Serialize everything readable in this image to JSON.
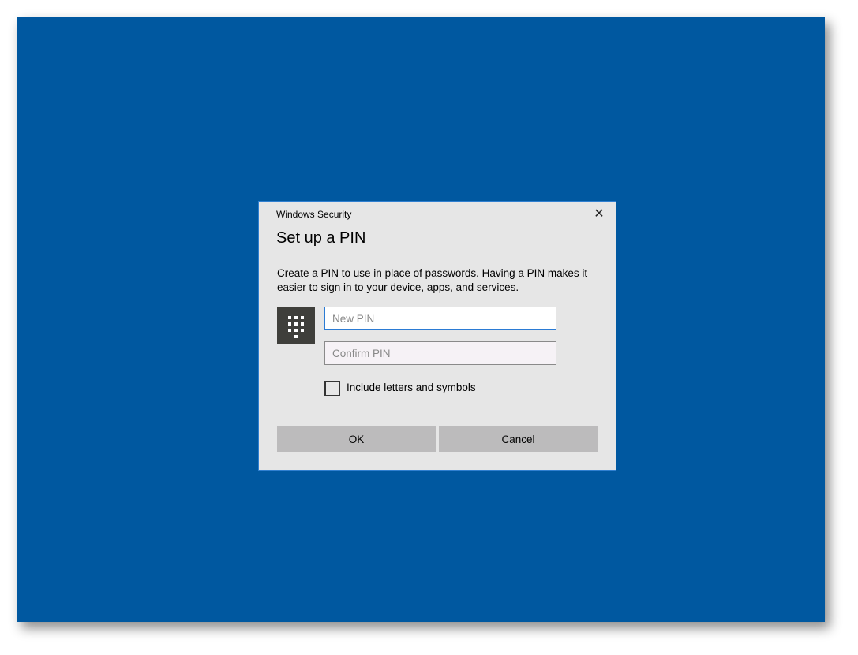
{
  "dialog": {
    "window_title": "Windows Security",
    "heading": "Set up a PIN",
    "description": "Create a PIN to use in place of passwords. Having a PIN makes it easier to sign in to your device, apps, and services.",
    "new_pin_placeholder": "New PIN",
    "confirm_pin_placeholder": "Confirm PIN",
    "checkbox_label": "Include letters and symbols",
    "ok_label": "OK",
    "cancel_label": "Cancel",
    "close_glyph": "✕"
  },
  "icons": {
    "pin": "keypad-icon",
    "close": "close-icon"
  },
  "colors": {
    "desktop": "#0058a0",
    "dialog": "#e6e6e6",
    "accent": "#2b7bd4"
  }
}
